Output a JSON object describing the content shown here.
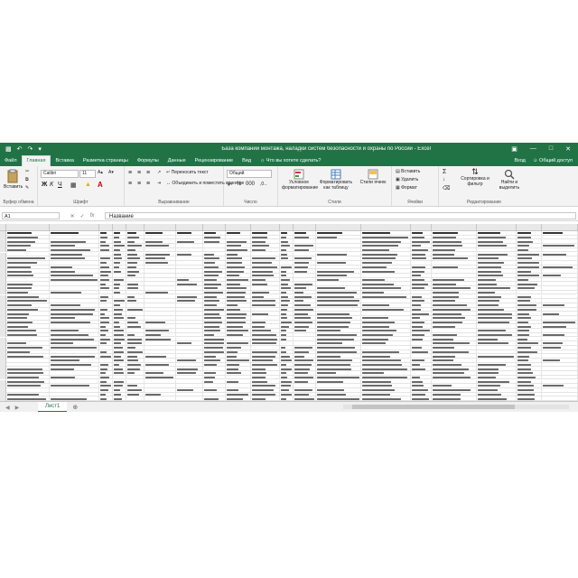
{
  "title": "База компаний монтажа, наладки систем безопасности и охраны по России - Excel",
  "window": {
    "user_label": "Вход",
    "share_label": "Общий доступ"
  },
  "tabs": [
    "Файл",
    "Главная",
    "Вставка",
    "Разметка страницы",
    "Формулы",
    "Данные",
    "Рецензирование",
    "Вид"
  ],
  "tell_me": "Что вы хотите сделать?",
  "ribbon": {
    "clipboard": {
      "paste": "Вставить",
      "group": "Буфер обмена"
    },
    "font": {
      "name": "Calibri",
      "size": "11",
      "group": "Шрифт"
    },
    "alignment": {
      "wrap": "Переносить текст",
      "merge": "Объединить и поместить в центре",
      "group": "Выравнивание"
    },
    "number": {
      "format": "Общий",
      "percent": "%",
      "group": "Число"
    },
    "styles": {
      "cond": "Условное форматирование",
      "table": "Форматировать как таблицу",
      "cell": "Стили ячеек",
      "group": "Стили"
    },
    "cells": {
      "insert": "Вставить",
      "delete": "Удалить",
      "format": "Формат",
      "group": "Ячейки"
    },
    "editing": {
      "sort": "Сортировка и фильтр",
      "find": "Найти и выделить",
      "group": "Редактирование"
    }
  },
  "formula_bar": {
    "cell_ref": "A1",
    "value": "Название",
    "fx": "fx"
  },
  "sheet": {
    "name": "Лист1"
  },
  "colors": {
    "brand": "#217346",
    "ribbon_bg": "#f3f3f3",
    "grid_line": "#e4e4e4"
  }
}
